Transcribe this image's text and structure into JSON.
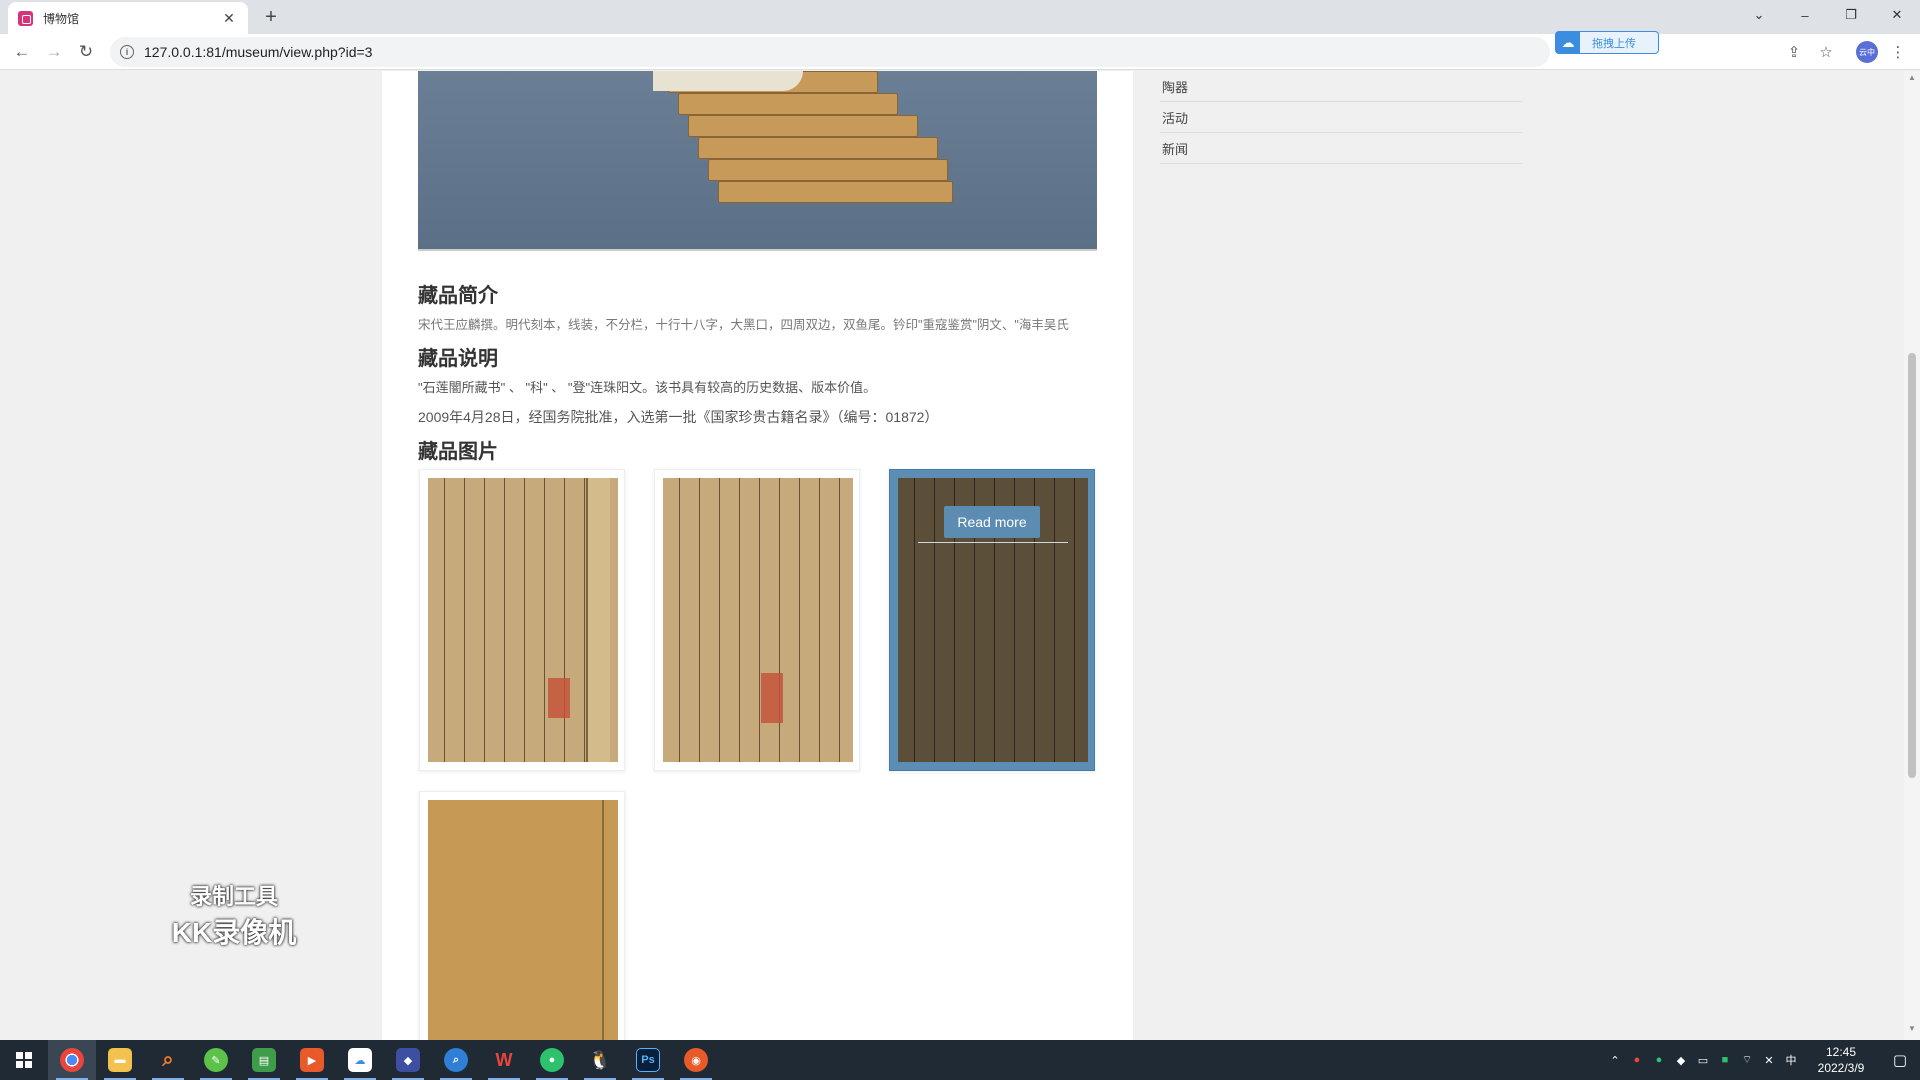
{
  "browser": {
    "tab_title": "博物馆",
    "url": "127.0.0.1:81/museum/view.php?id=3",
    "upload_label": "拖拽上传",
    "avatar_text": "云中"
  },
  "sidebar": {
    "items": [
      {
        "label": "陶器"
      },
      {
        "label": "活动"
      },
      {
        "label": "新闻"
      }
    ]
  },
  "main": {
    "intro_title": "藏品简介",
    "intro_text": "宋代王应麟撰。明代刻本，线装，不分栏，十行十八字，大黑口，四周双边，双鱼尾。钤印\"重寇鉴赏\"阴文、\"海丰吴氏",
    "desc_title": "藏品说明",
    "desc_line1": "\"石莲闇所藏书\" 、 \"科\" 、 \"登\"连珠阳文。该书具有较高的历史数据、版本价值。",
    "desc_line2": "2009年4月28日，经国务院批准，入选第一批《国家珍贵古籍名录》（编号：01872）",
    "images_title": "藏品图片",
    "read_more": "Read more"
  },
  "watermark": {
    "line1": "录制工具",
    "line2": "KK录像机"
  },
  "taskbar": {
    "time": "12:45",
    "date": "2022/3/9",
    "ime": "中",
    "ps_label": "Ps"
  },
  "colors": {
    "accent": "#5d8cb3",
    "taskbar": "#1f2a35"
  }
}
